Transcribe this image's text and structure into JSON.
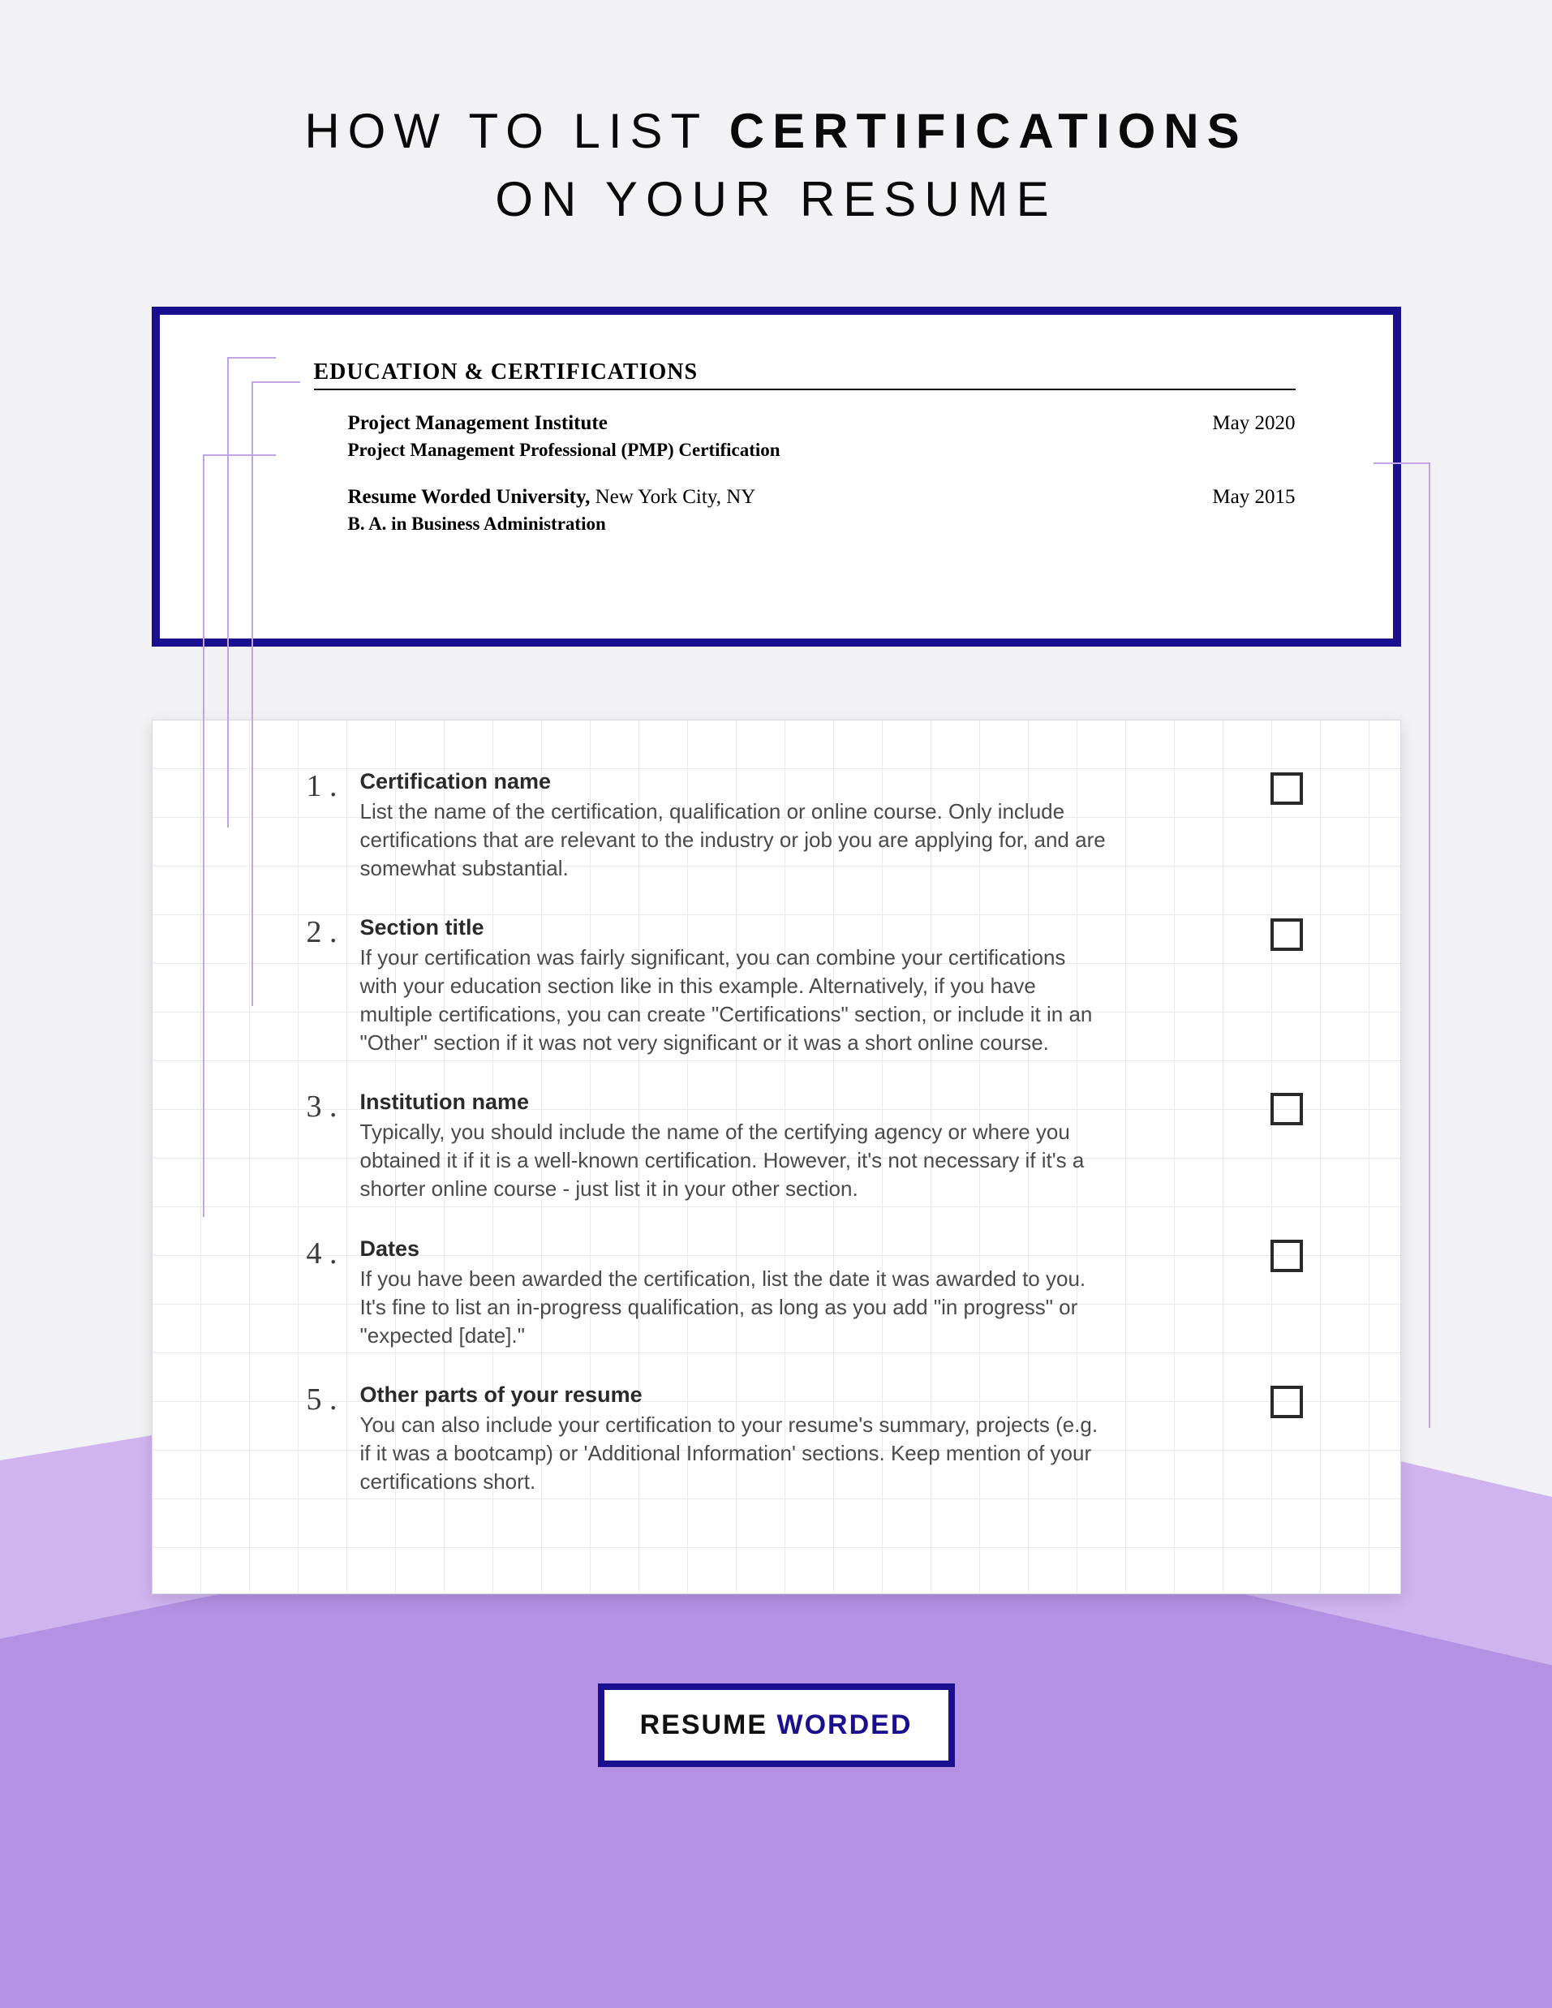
{
  "title": {
    "line1_pre": "HOW TO LIST ",
    "line1_bold": "CERTIFICATIONS",
    "line2": "ON YOUR RESUME"
  },
  "sample": {
    "heading": "EDUCATION & CERTIFICATIONS",
    "entries": [
      {
        "institution": "Project Management Institute",
        "location": "",
        "subline": "Project Management Professional (PMP) Certification",
        "date": "May 2020"
      },
      {
        "institution": "Resume Worded University,",
        "location": " New York City, NY",
        "subline": "B. A. in Business Administration",
        "date": "May 2015"
      }
    ]
  },
  "checklist": [
    {
      "num": "1 .",
      "title": "Certification name",
      "desc": "List the name of the certification, qualification or online course. Only include certifications that are relevant to the industry or job you are applying for, and are somewhat substantial."
    },
    {
      "num": "2 .",
      "title": "Section title",
      "desc": "If your certification was fairly significant, you can combine your certifications with your education section like in this example. Alternatively, if you have multiple certifications, you can create \"Certifications\" section, or include it in an \"Other\" section if it was not very significant or it was a short online course."
    },
    {
      "num": "3 .",
      "title": "Institution name",
      "desc": "Typically, you should include the name of the certifying agency or where you obtained it if it is a well-known certification. However, it's not necessary if it's a shorter online course - just list it in your other section."
    },
    {
      "num": "4 .",
      "title": "Dates",
      "desc": "If you have been awarded the certification, list the date it was awarded to you. It's fine to list an in-progress qualification, as long as you add \"in progress\" or \"expected [date].\""
    },
    {
      "num": "5 .",
      "title": "Other parts of your resume",
      "desc": "You can also include your certification to your resume's summary, projects (e.g. if it was a bootcamp) or 'Additional Information' sections. Keep mention of your certifications short."
    }
  ],
  "footer": {
    "brand_a": "RESUME",
    "brand_b": " WORDED"
  }
}
